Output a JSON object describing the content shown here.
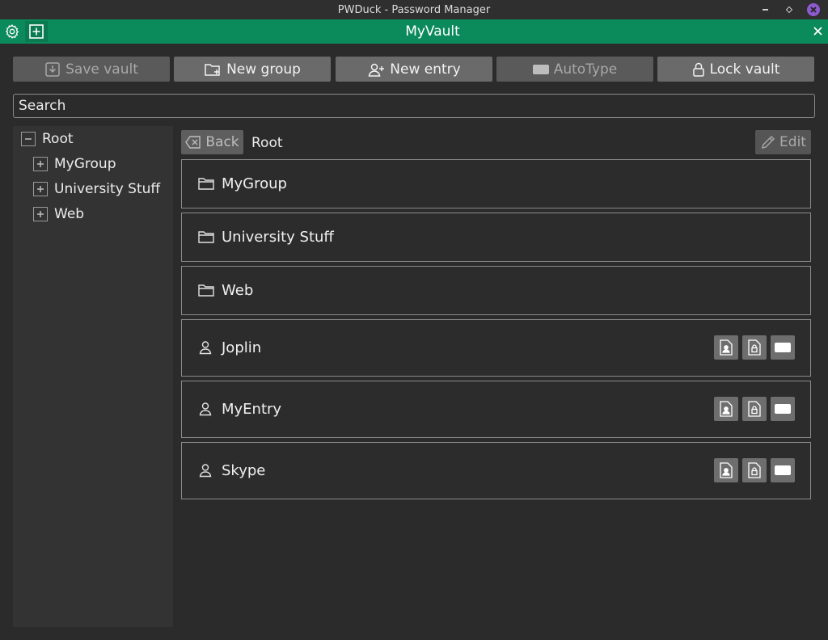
{
  "window": {
    "title": "PWDuck - Password Manager"
  },
  "tab": {
    "title": "MyVault"
  },
  "toolbar": {
    "save": "Save vault",
    "new_group": "New group",
    "new_entry": "New entry",
    "autotype": "AutoType",
    "lock": "Lock vault"
  },
  "search": {
    "placeholder": "Search",
    "value": ""
  },
  "tree": {
    "root": "Root",
    "children": [
      "MyGroup",
      "University Stuff",
      "Web"
    ]
  },
  "header": {
    "back": "Back",
    "breadcrumb": "Root",
    "edit": "Edit"
  },
  "groups": [
    "MyGroup",
    "University Stuff",
    "Web"
  ],
  "entries": [
    "Joplin",
    "MyEntry",
    "Skype"
  ],
  "colors": {
    "accent": "#0b8a5b",
    "background": "#2b2b2b",
    "panel": "#333333",
    "button": "#6a6a6a"
  }
}
